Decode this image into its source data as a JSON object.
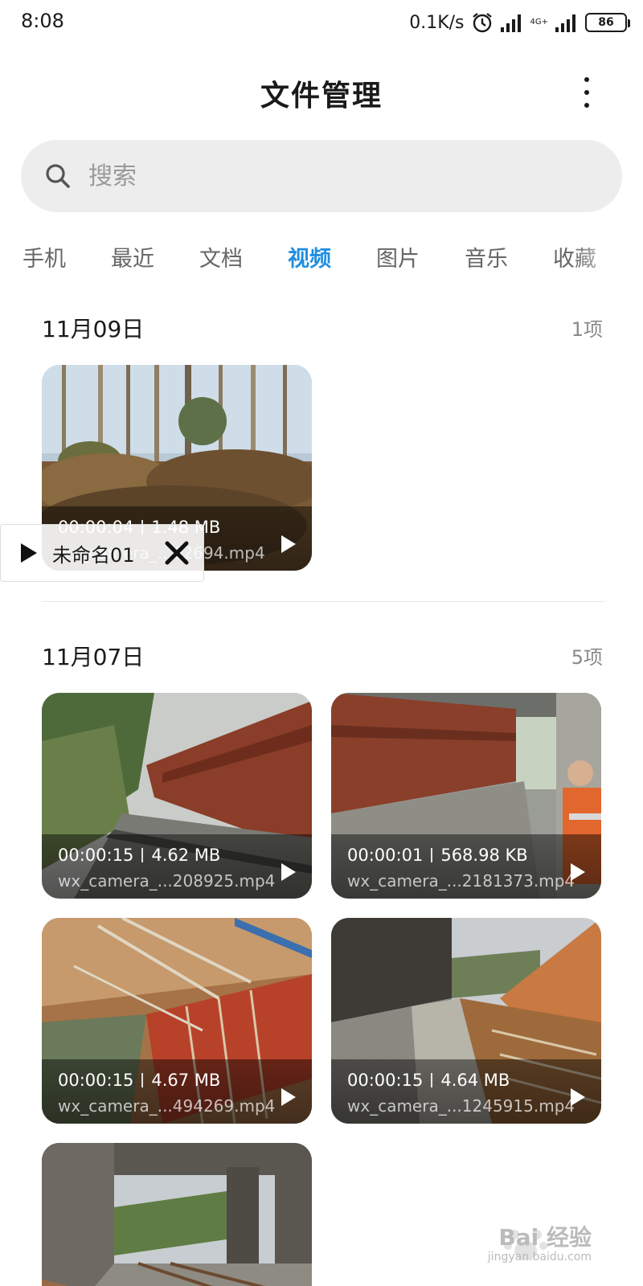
{
  "status_bar": {
    "time": "8:08",
    "net_speed": "0.1K/s",
    "network_type": "4G+",
    "battery": "86"
  },
  "header": {
    "title": "文件管理"
  },
  "search": {
    "placeholder": "搜索"
  },
  "tabs": [
    {
      "label": "手机",
      "active": false
    },
    {
      "label": "最近",
      "active": false
    },
    {
      "label": "文档",
      "active": false
    },
    {
      "label": "视频",
      "active": true
    },
    {
      "label": "图片",
      "active": false
    },
    {
      "label": "音乐",
      "active": false
    },
    {
      "label": "收藏",
      "active": false
    }
  ],
  "sections": [
    {
      "date": "11月09日",
      "count": "1项",
      "videos": [
        {
          "duration": "00:00:04",
          "size": "1.48 MB",
          "filename": "wx_camera_...62694.mp4"
        }
      ]
    },
    {
      "date": "11月07日",
      "count": "5项",
      "videos": [
        {
          "duration": "00:00:15",
          "size": "4.62 MB",
          "filename": "wx_camera_...208925.mp4"
        },
        {
          "duration": "00:00:01",
          "size": "568.98 KB",
          "filename": "wx_camera_...2181373.mp4"
        },
        {
          "duration": "00:00:15",
          "size": "4.67 MB",
          "filename": "wx_camera_...494269.mp4"
        },
        {
          "duration": "00:00:15",
          "size": "4.64 MB",
          "filename": "wx_camera_...1245915.mp4"
        }
      ]
    }
  ],
  "mini_player": {
    "title": "未命名01"
  },
  "watermark": {
    "text": "Bai 经验",
    "url_text": "jingyan.baidu.com"
  },
  "colors": {
    "accent": "#1f8fe0",
    "search_bg": "#ededed",
    "tab_inactive": "#666666"
  }
}
